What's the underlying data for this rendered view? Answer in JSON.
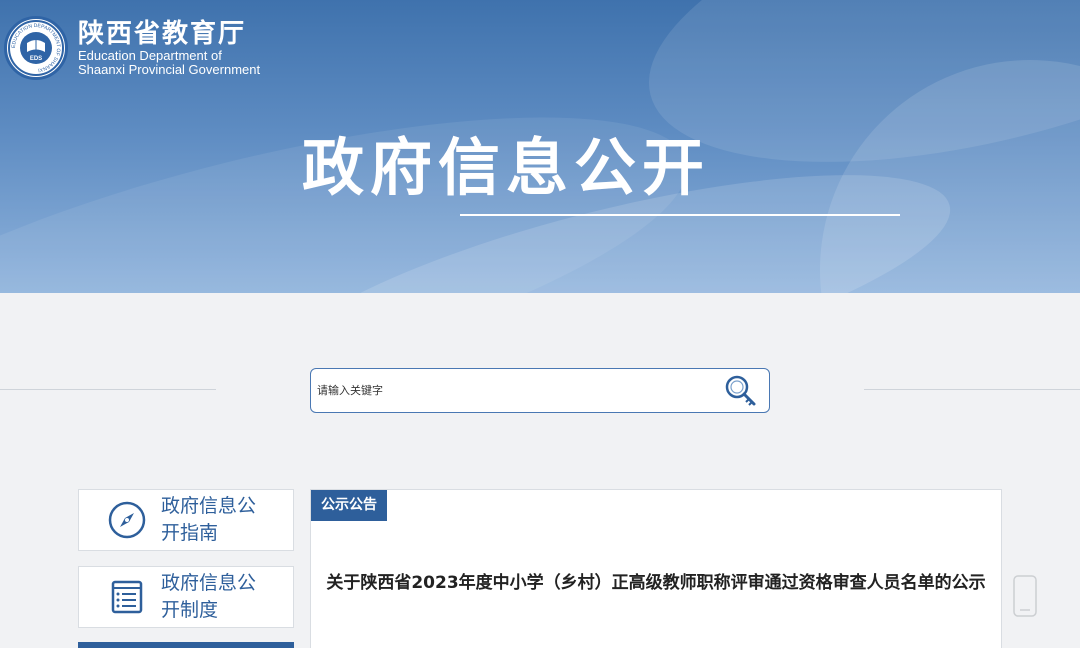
{
  "header": {
    "org_name_cn": "陕西省教育厅",
    "org_name_en_line1": "Education Department of",
    "org_name_en_line2": "Shaanxi Provincial Government",
    "logo_ring_text": "EDUCATION DEPARTMENT OF SHAANXI",
    "logo_center_text": "EDS",
    "banner_title": "政府信息公开"
  },
  "search": {
    "placeholder": "请输入关键字",
    "icon": "search-key-icon"
  },
  "sidebar": {
    "items": [
      {
        "label": "政府信息公开指南",
        "icon": "compass-icon"
      },
      {
        "label": "政府信息公开制度",
        "icon": "document-list-icon"
      }
    ]
  },
  "main": {
    "tab_label": "公示公告",
    "notice_title": "关于陕西省2023年度中小学（乡村）正高级教师职称评审通过资格审查人员名单的公示"
  },
  "colors": {
    "accent": "#2e5f9b",
    "banner_top": "#3f72ad",
    "banner_bottom": "#8fb3dc",
    "page_bg": "#f1f2f4"
  }
}
